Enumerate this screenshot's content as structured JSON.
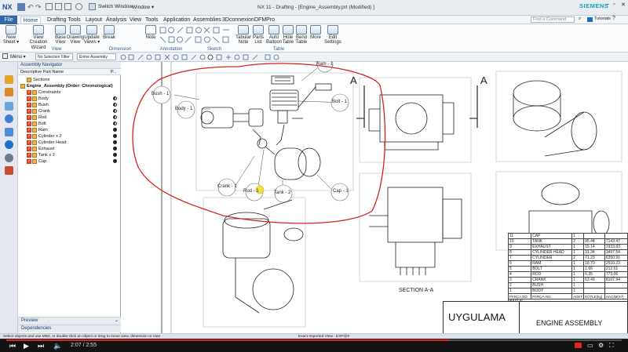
{
  "titlebar": {
    "app_logo": "NX",
    "switch_window": "Switch Window",
    "window_menu": "Window ▾",
    "title": "NX 11 - Drafting - [Engine_Assembly.prt (Modified) ]",
    "brand": "SIEMENS",
    "search_placeholder": "Find a Command",
    "tutorials": "Tutorials"
  },
  "menu_tabs": [
    "File",
    "Home",
    "Drafting Tools",
    "Layout",
    "Analysis",
    "View",
    "Tools",
    "Application",
    "Assemblies",
    "3Dconnexion",
    "DFMPro"
  ],
  "ribbon": {
    "buttons": [
      {
        "label": "New Sheet ▾"
      },
      {
        "label": "View Creation Wizard"
      },
      {
        "label": "Base View"
      },
      {
        "label": "Drawing View"
      },
      {
        "label": "Update Views ▾"
      },
      {
        "label": "Break"
      },
      {
        "label": "Note"
      },
      {
        "label": "Tabular Note"
      },
      {
        "label": "Parts List"
      },
      {
        "label": "Auto Balloon"
      },
      {
        "label": "Hole Table"
      },
      {
        "label": "Bend Table"
      },
      {
        "label": "More"
      },
      {
        "label": "Edit Settings"
      }
    ],
    "groups": [
      "View",
      "Dimension",
      "Annotation",
      "Sketch",
      "Table"
    ]
  },
  "toolbar2": {
    "menu_label": "Menu ▾",
    "filter_select": "No Selection Filter",
    "scope_select": "Entire Assembly"
  },
  "navigator": {
    "title": "Assembly Navigator",
    "col_name": "Descriptive Part Name",
    "col_p": "P...",
    "rows": [
      {
        "label": "Sections",
        "indent": 1
      },
      {
        "label": "Engine_Assembly (Order: Chronological)",
        "indent": 0
      },
      {
        "label": "Constraints",
        "indent": 1
      },
      {
        "label": "Body",
        "indent": 1
      },
      {
        "label": "Bush",
        "indent": 1
      },
      {
        "label": "Crank",
        "indent": 1
      },
      {
        "label": "Rod",
        "indent": 1
      },
      {
        "label": "Bolt",
        "indent": 1
      },
      {
        "label": "Ram",
        "indent": 1
      },
      {
        "label": "Cylinder x 2",
        "indent": 1
      },
      {
        "label": "Cylinder Head",
        "indent": 1
      },
      {
        "label": "Exhaust",
        "indent": 1
      },
      {
        "label": "Tank x 2",
        "indent": 1
      },
      {
        "label": "Cap",
        "indent": 1
      }
    ],
    "preview": "Preview",
    "dependencies": "Dependencies"
  },
  "drawing": {
    "balloons": [
      "Ram - 1",
      "Bush - 1",
      "Body - 1",
      "Bolt - 1",
      "Crank - 1",
      "Rod - 1",
      "Tank - 2",
      "Cap - 1"
    ],
    "section_letter": "A",
    "section_label": "SECTION A-A",
    "parts_table": {
      "headers": [
        "PARÇA NO",
        "PARÇA ADI",
        "ADET",
        "KÜTLE(kg)",
        "HACİM(m³)"
      ],
      "rows": [
        [
          "11",
          "CAP",
          "1",
          "",
          ""
        ],
        [
          "10",
          "TANK",
          "2",
          "95.44",
          "7143.47"
        ],
        [
          "9",
          "EXHAUST",
          "1",
          "15.14",
          "1933.83"
        ],
        [
          "8",
          "CYLINDER HEAD",
          "1",
          "31.34",
          "3497.54"
        ],
        [
          "7",
          "CYLINDER",
          "2",
          "71.23",
          "6350.91"
        ],
        [
          "6",
          "RAM",
          "1",
          "18.70",
          "2510.23"
        ],
        [
          "5",
          "BOLT",
          "1",
          "1.66",
          "212.51"
        ],
        [
          "4",
          "ROD",
          "1",
          "6.35",
          "773.06"
        ],
        [
          "3",
          "CRANK",
          "1",
          "63.49",
          "8107.94"
        ],
        [
          "2",
          "BUSH",
          "1",
          "",
          ""
        ],
        [
          "1",
          "BODY",
          "1",
          "",
          ""
        ]
      ],
      "footer_label": "BAŞLIK"
    },
    "title_left": "UYGULAMA",
    "title_right": "ENGINE ASSEMBLY"
  },
  "statusbar": {
    "left": "Select objects and use MB3, or double-click an object or drag to move view, dimension or note",
    "center": "Exact Imported View : EXP@9"
  },
  "video": {
    "time": "2:07 / 2:55",
    "progress": 0.72
  }
}
